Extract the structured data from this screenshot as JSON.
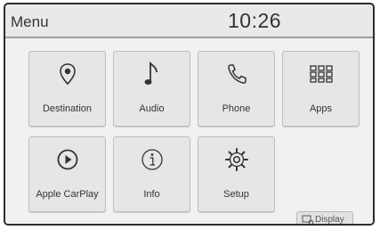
{
  "header": {
    "title": "Menu",
    "clock": "10:26"
  },
  "tiles": [
    {
      "label": "Destination",
      "icon": "map-pin-icon"
    },
    {
      "label": "Audio",
      "icon": "music-note-icon"
    },
    {
      "label": "Phone",
      "icon": "phone-icon"
    },
    {
      "label": "Apps",
      "icon": "grid-icon"
    },
    {
      "label": "Apple CarPlay",
      "icon": "play-circle-icon"
    },
    {
      "label": "Info",
      "icon": "info-icon"
    },
    {
      "label": "Setup",
      "icon": "gear-icon"
    }
  ],
  "display_button": {
    "label": "Display",
    "icon": "display-icon"
  },
  "colors": {
    "background": "#f1f1f1",
    "tile": "#e6e6e6",
    "text": "#333333"
  }
}
